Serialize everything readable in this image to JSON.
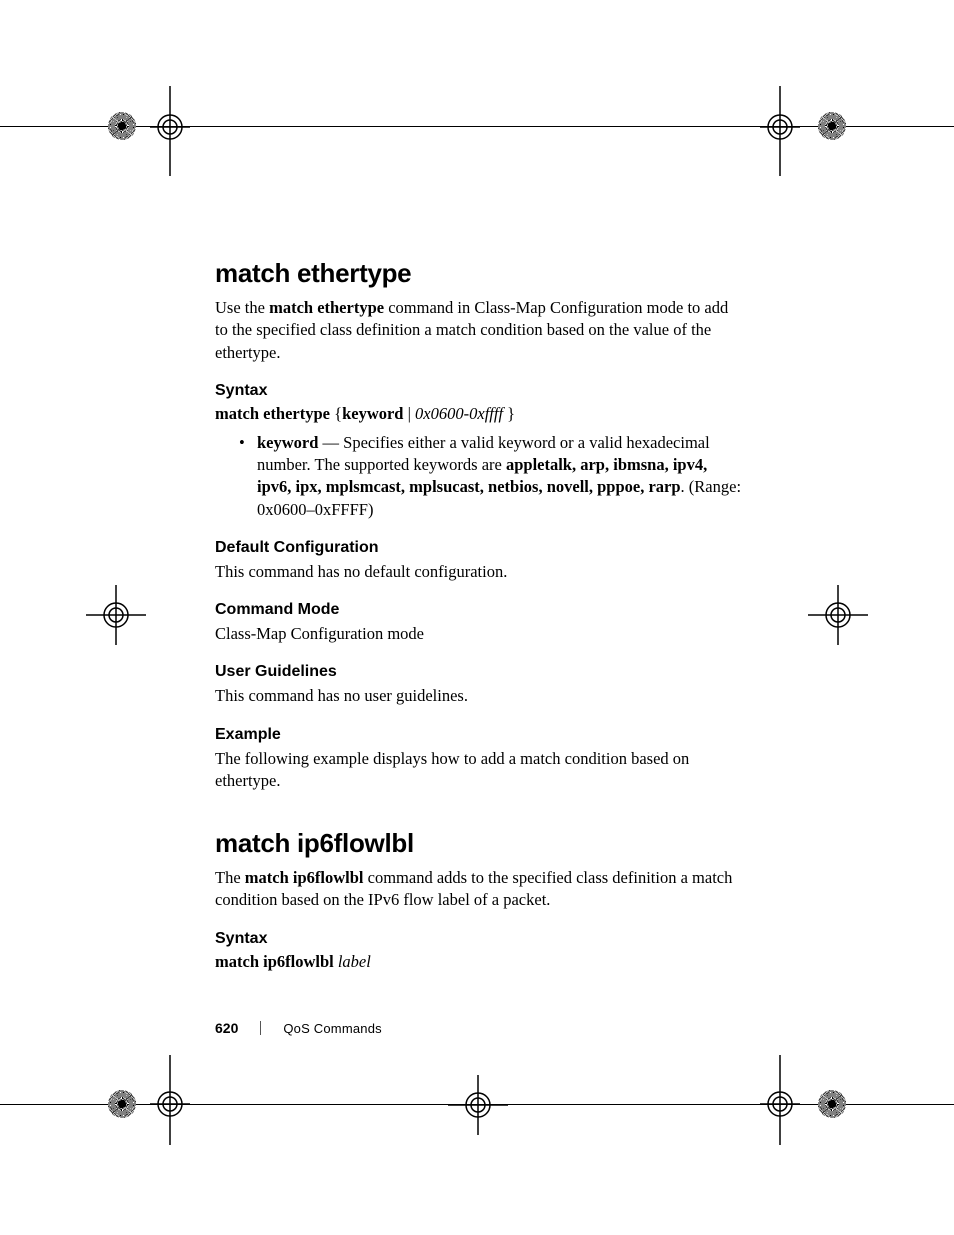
{
  "footer": {
    "page_number": "620",
    "chapter": "QoS Commands"
  },
  "cmd1": {
    "title": "match ethertype",
    "intro_pre": "Use the ",
    "intro_bold": "match ethertype",
    "intro_post": " command in Class-Map Configuration mode to add to the specified class definition a match condition based on the value of the ethertype.",
    "syntax_heading": "Syntax",
    "syntax_b1": "match ethertype",
    "syntax_plain1": " {",
    "syntax_b2": "keyword",
    "syntax_plain2": " | ",
    "syntax_ital": "0x0600-0xffff ",
    "syntax_plain3": "}",
    "bullet_kw": "keyword",
    "bullet_dash": " — Specifies either a valid keyword or a valid hexadecimal number. The supported keywords are ",
    "bullet_keywords": "appletalk, arp, ibmsna, ipv4, ipv6, ipx, mplsmcast, mplsucast, netbios, novell, pppoe, rarp",
    "bullet_tail": ". (Range: 0x0600–0xFFFF)",
    "defcfg_heading": "Default Configuration",
    "defcfg_text": "This command has no default configuration.",
    "mode_heading": "Command Mode",
    "mode_text": "Class-Map Configuration mode",
    "ug_heading": "User Guidelines",
    "ug_text": "This command has no user guidelines.",
    "ex_heading": "Example",
    "ex_text": "The following example displays how to add a match condition based on ethertype."
  },
  "cmd2": {
    "title": "match ip6flowlbl",
    "intro_pre": "The ",
    "intro_bold": "match ip6flowlbl",
    "intro_post": " command adds to the specified class definition a match condition based on the IPv6 flow label of a packet.",
    "syntax_heading": "Syntax",
    "syntax_b1": "match ip6flowlbl ",
    "syntax_ital": "label"
  }
}
